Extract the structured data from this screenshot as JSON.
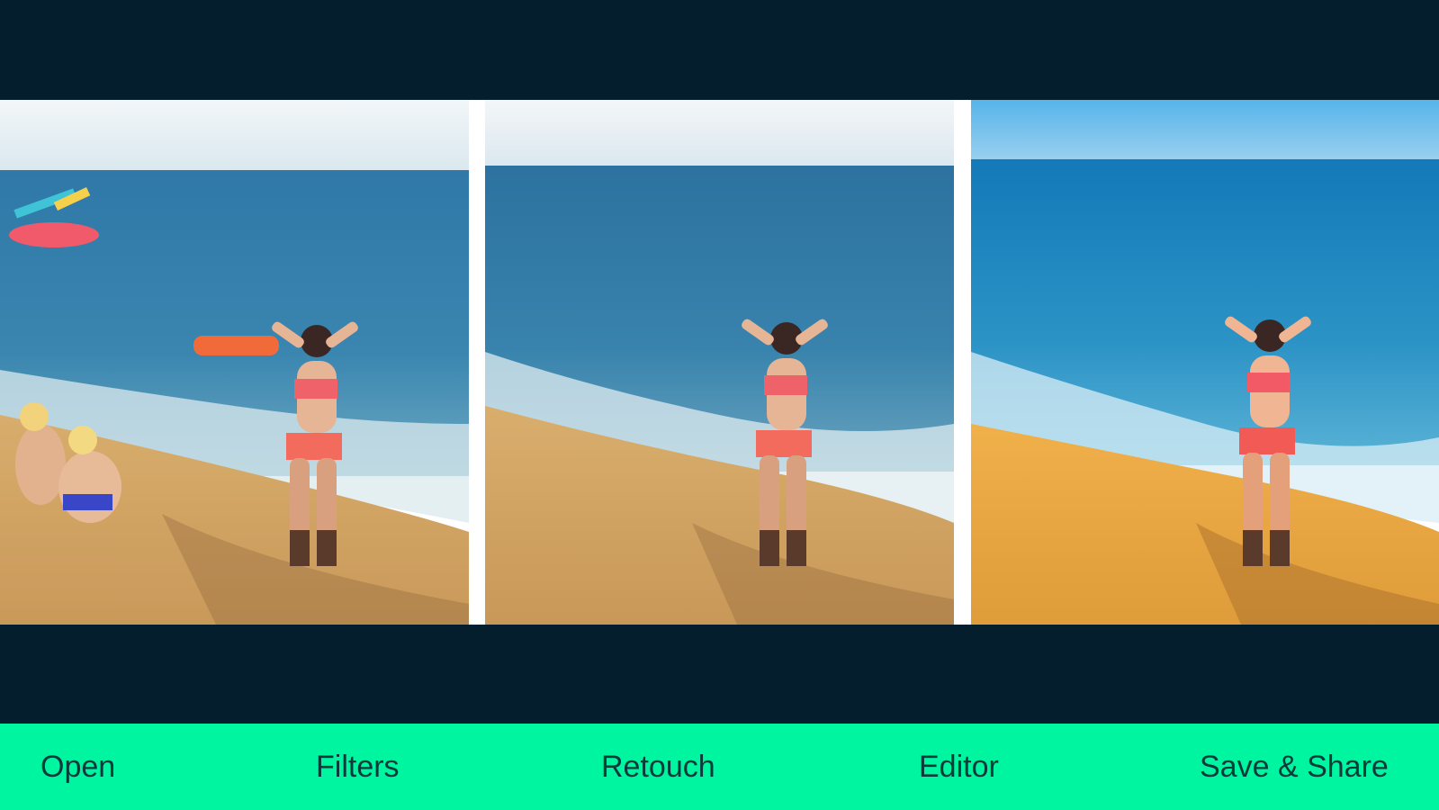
{
  "app": {
    "background_color": "#051e2e",
    "accent_color": "#00f5a0"
  },
  "photos": [
    {
      "description_icon": "beach-photo-original"
    },
    {
      "description_icon": "beach-photo-retouched"
    },
    {
      "description_icon": "beach-photo-enhanced"
    }
  ],
  "toolbar": {
    "open_label": "Open",
    "filters_label": "Filters",
    "retouch_label": "Retouch",
    "editor_label": "Editor",
    "save_share_label": "Save & Share"
  }
}
